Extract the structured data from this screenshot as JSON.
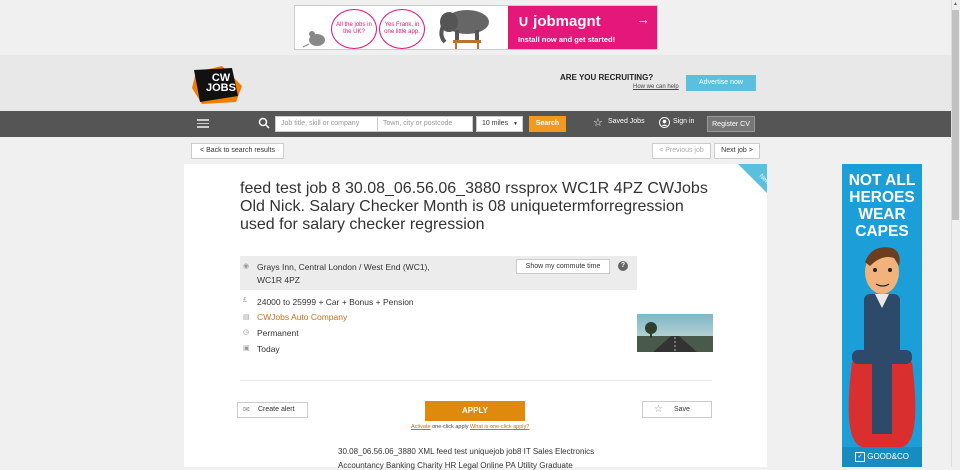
{
  "top_ad": {
    "bubble1": "All the jobs in the UK?",
    "bubble2": "Yes Frank, in one little app.",
    "brand": "jobmagnt",
    "cta": "Install now and get started!",
    "brand_color": "#e4177a"
  },
  "header": {
    "logo_text_top": "CW",
    "logo_text_bottom": "JOBS",
    "recruiting": "ARE YOU RECRUITING?",
    "how_we_can_help": "How we can help",
    "advertise_button": "Advertise now"
  },
  "nav": {
    "keyword_placeholder": "Job title, skill or company",
    "location_placeholder": "Town, city or postcode",
    "radius": "10 miles",
    "search_button": "Search",
    "saved_jobs": "Saved Jobs",
    "sign_in": "Sign in",
    "register_cv": "Register CV"
  },
  "pagination": {
    "back": "< Back to search results",
    "previous": "< Previous job",
    "next": "Next job >"
  },
  "job": {
    "new_badge": "New",
    "title": "feed test job 8 30.08_06.56.06_3880 rssprox WC1R 4PZ CWJobs Old Nick. Salary Checker Month is 08 uniquetermforregression used for salary checker regression",
    "location_line1": "Grays Inn, Central London / West End (WC1),",
    "location_line2": "WC1R 4PZ",
    "commute_button": "Show my commute time",
    "salary": "24000 to 25999 + Car + Bonus + Pension",
    "company": "CWJobs Auto Company",
    "job_type": "Permanent",
    "posted": "Today",
    "create_alert": "Create alert",
    "apply_button": "APPLY",
    "activate_link": "Activate",
    "activate_text": "one-click apply",
    "what_is": "What is one-click apply?",
    "save_button": "Save",
    "description_line1": "30.08_06.56.06_3880 XML feed test uniquejob job8 IT Sales Electronics",
    "description_line2": "Accountancy Banking Charity HR Legal Online PA Utility Graduate"
  },
  "side_ad": {
    "line1": "NOT ALL",
    "line2": "HEROES",
    "line3": "WEAR",
    "line4": "CAPES",
    "footer": "GOOD&CO",
    "color": "#1c9fd8"
  },
  "colors": {
    "accent_orange": "#e08a0d",
    "nav_bg": "#555555",
    "company_link": "#c8701e"
  }
}
